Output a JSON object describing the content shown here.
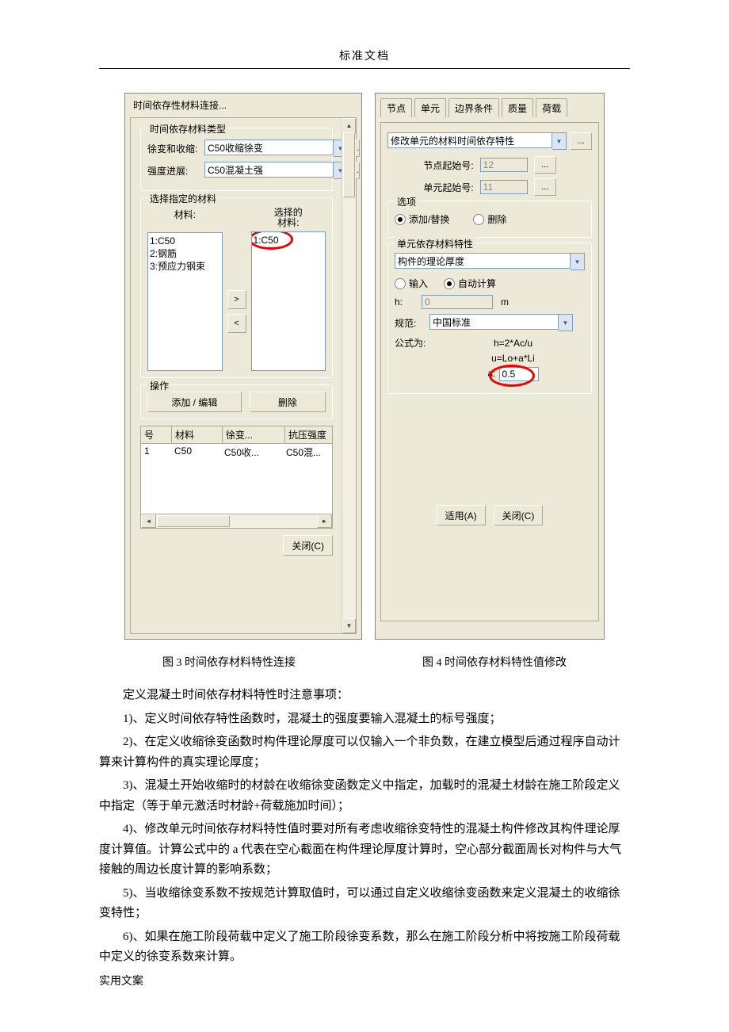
{
  "header": "标准文档",
  "footer": "实用文案",
  "left": {
    "title": "时间依存性材料连接...",
    "grp1": "时间依存材料类型",
    "creep_lbl": "徐变和收缩:",
    "creep_val": "C50收缩徐变",
    "str_lbl": "强度进展:",
    "str_val": "C50混凝土强",
    "grp2": "选择指定的材料",
    "mat_lbl": "材料:",
    "sel_lbl": "选择的\n材料:",
    "mat_items": [
      "1:C50",
      "2:钢筋",
      "3:预应力钢束"
    ],
    "sel_items": [
      "1:C50"
    ],
    "grp3": "操作",
    "add_edit": "添加 / 编辑",
    "del": "删除",
    "cols": {
      "c1": "号",
      "c2": "材料",
      "c3": "徐变...",
      "c4": "抗压强度"
    },
    "row": {
      "c1": "1",
      "c2": "C50",
      "c3": "C50收...",
      "c4": "C50混..."
    },
    "close": "关闭(C)",
    "dots": "..."
  },
  "right": {
    "tabs": [
      "节点",
      "单元",
      "边界条件",
      "质量",
      "荷载"
    ],
    "combo": "修改单元的材料时间依存特性",
    "node_lbl": "节点起始号:",
    "node_val": "12",
    "elem_lbl": "单元起始号:",
    "elem_val": "11",
    "opt": "选项",
    "opt1": "添加/替换",
    "opt2": "删除",
    "grp": "单元依存材料特性",
    "dd": "构件的理论厚度",
    "r1": "输入",
    "r2": "自动计算",
    "h_lbl": "h:",
    "h_val": "0",
    "h_unit": "m",
    "spec_lbl": "规范:",
    "spec_val": "中国标准",
    "f_lbl": "公式为:",
    "f1": "h=2*Ac/u",
    "f2": "u=Lo+a*Li",
    "a_lbl": "a:",
    "a_val": "0.5",
    "apply": "适用(A)",
    "close": "关闭(C)",
    "dots": "..."
  },
  "captions": {
    "c1": "图 3 时间依存材料特性连接",
    "c2": "图 4 时间依存材料特性值修改"
  },
  "text": {
    "intro": "定义混凝土时间依存材料特性时注意事项：",
    "p1": "1)、定义时间依存特性函数时，混凝土的强度要输入混凝土的标号强度；",
    "p2": "2)、在定义收缩徐变函数时构件理论厚度可以仅输入一个非负数，在建立模型后通过程序自动计算来计算构件的真实理论厚度；",
    "p3": "3)、混凝土开始收缩时的材龄在收缩徐变函数定义中指定，加载时的混凝土材龄在施工阶段定义中指定（等于单元激活时材龄+荷载施加时间）；",
    "p4": "4)、修改单元时间依存材料特性值时要对所有考虑收缩徐变特性的混凝土构件修改其构件理论厚度计算值。计算公式中的 a 代表在空心截面在构件理论厚度计算时，空心部分截面周长对构件与大气接触的周边长度计算的影响系数；",
    "p5": "5)、当收缩徐变系数不按规范计算取值时，可以通过自定义收缩徐变函数来定义混凝土的收缩徐变特性；",
    "p6": "6)、如果在施工阶段荷载中定义了施工阶段徐变系数，那么在施工阶段分析中将按施工阶段荷载中定义的徐变系数来计算。"
  }
}
